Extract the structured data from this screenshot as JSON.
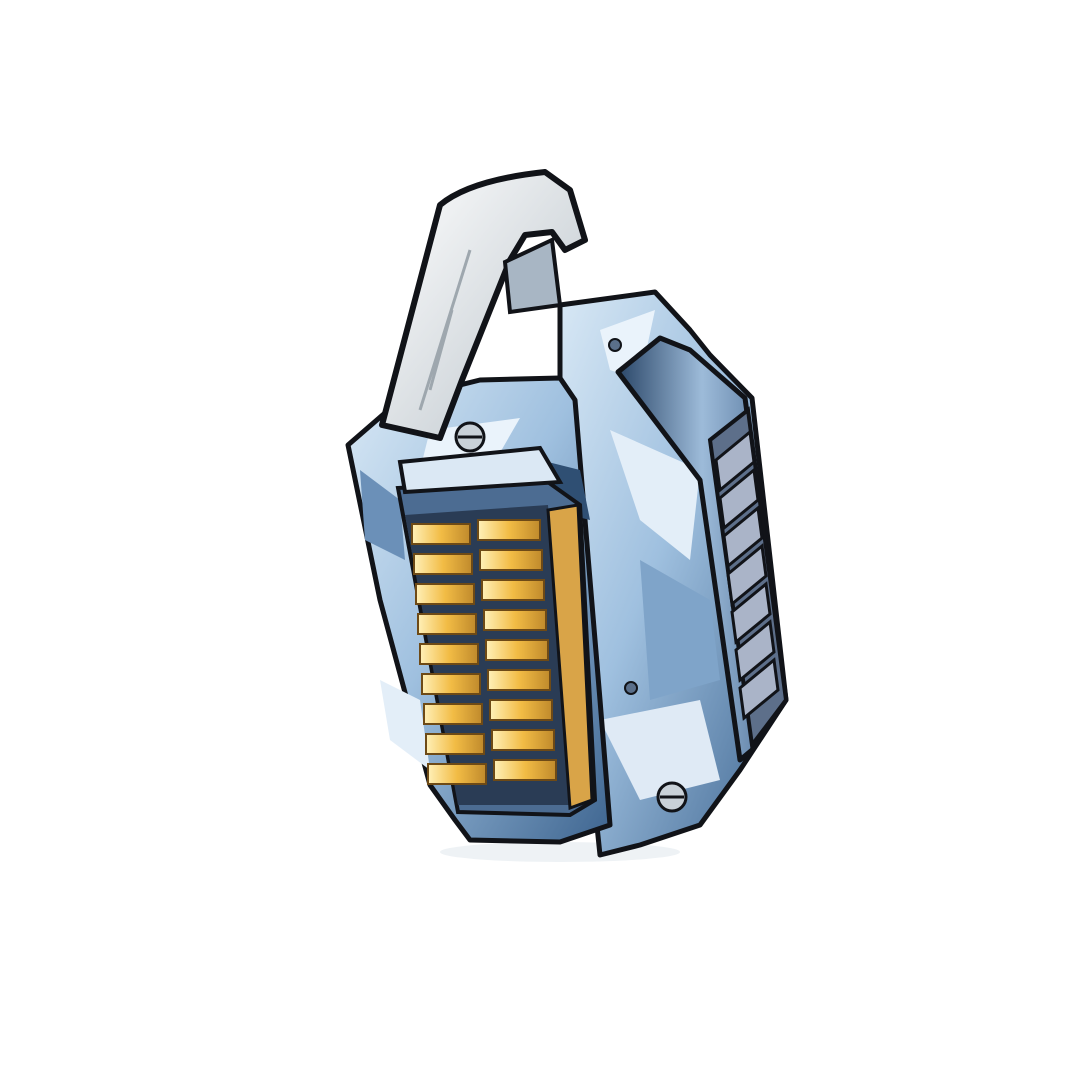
{
  "scene": {
    "subject_icon": "grenade-icon",
    "background_color": "#ffffff",
    "colors": {
      "outline": "#111318",
      "body_light": "#cfe2f2",
      "body_mid": "#8eb3d6",
      "body_dark": "#2f4f73",
      "handle": "#e9edf0",
      "glow": "#f4c453",
      "glow_dark": "#a9782a",
      "slat": "#9aa6bd"
    }
  }
}
